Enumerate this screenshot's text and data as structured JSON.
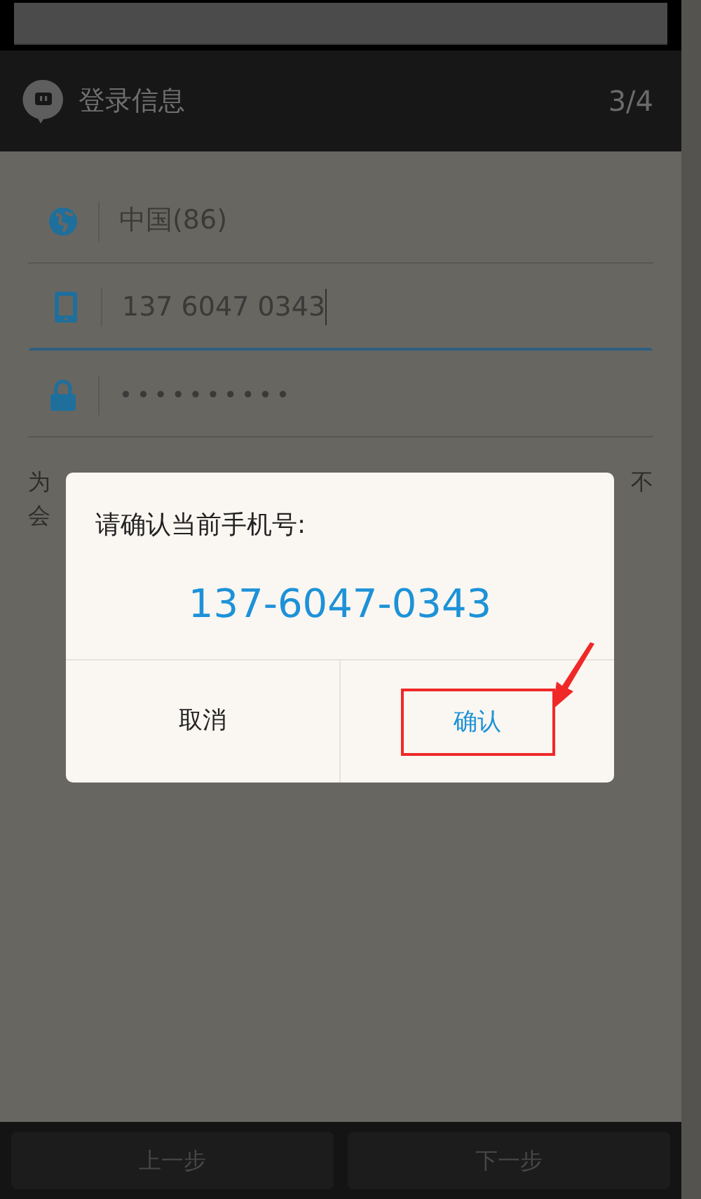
{
  "header": {
    "title": "登录信息",
    "step": "3/4"
  },
  "fields": [
    {
      "kind": "country",
      "value": "中国(86)",
      "focused": false
    },
    {
      "kind": "phone",
      "value": "137 6047 0343",
      "focused": true
    },
    {
      "kind": "password",
      "value": "••••••••••",
      "focused": false
    }
  ],
  "hint_fragments": {
    "line1_left": "为",
    "line1_right": "不",
    "line2_left": "会"
  },
  "dialog": {
    "title": "请确认当前手机号:",
    "number": "137-6047-0343",
    "buttons": [
      {
        "label": "取消",
        "highlighted": false
      },
      {
        "label": "确认",
        "highlighted": true
      }
    ]
  },
  "footer": {
    "buttons": [
      "上一步",
      "下一步"
    ]
  }
}
